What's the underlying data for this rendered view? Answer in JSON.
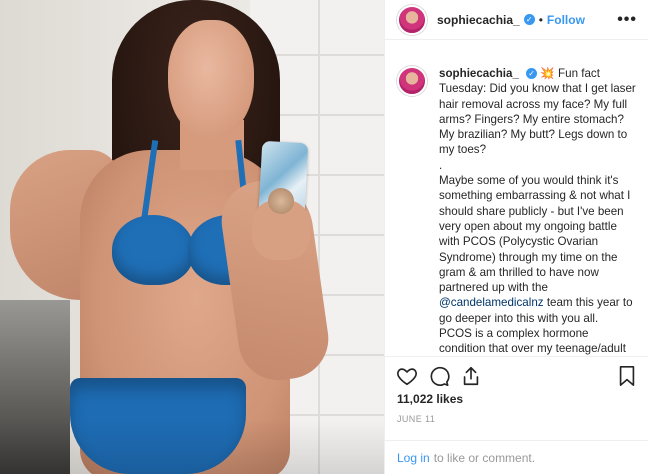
{
  "post": {
    "username": "sophiecachia_",
    "verified_glyph": "✓",
    "separator": "•",
    "follow_label": "Follow",
    "more_label": "•••",
    "caption_emoji": "💥",
    "caption_lines": [
      "Fun fact Tuesday: Did you know that I get laser hair removal across my face? My full arms? Fingers? My entire stomach? My brazilian? My butt? Legs down to my toes?",
      ".",
      "Maybe some of you would think it's something embarrassing & not what I should share publicly - but I've been very open about my ongoing battle with PCOS (Polycystic Ovarian Syndrome) through my time on the gram & am thrilled to have now partnered up with the"
    ],
    "mention": "@candelamedicalnz",
    "caption_after_mention": "team this year to go deeper into this with you all.",
    "caption_tail": "PCOS is a complex hormone condition that over my teenage/adult hood has given me such side effects; an",
    "likes": "11,022 likes",
    "date": "JUNE 11"
  },
  "login": {
    "link_label": "Log in",
    "rest": "to like or comment."
  },
  "icons": {
    "like": "heart-icon",
    "comment": "comment-icon",
    "share": "share-icon",
    "save": "bookmark-icon"
  },
  "colors": {
    "accent": "#3897f0",
    "mention": "#003569",
    "meta": "#999999",
    "bikini": "#1f6fb7"
  }
}
